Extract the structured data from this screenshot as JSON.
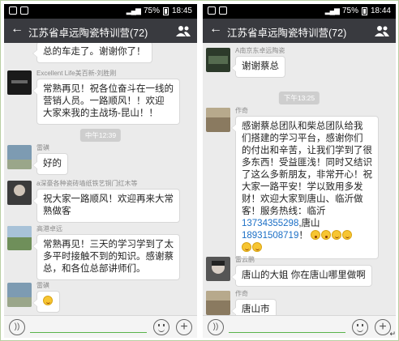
{
  "left_phone": {
    "status": {
      "battery": "75%",
      "time": "18:45"
    },
    "header": {
      "title": "江苏省卓远陶瓷特训营(72)"
    },
    "messages": [
      {
        "type": "partial",
        "text": "总的车走了。谢谢你了！"
      },
      {
        "type": "msg",
        "sender": "Excellent Life美百新-刘胜刚",
        "avatar_color": "#1a1a1a",
        "lines": [
          "常熟再见！祝各位奋斗在一线的",
          "营销人员。一路顺风！！欢迎",
          "大家来我的主战场-昆山！！"
        ]
      },
      {
        "type": "time",
        "text": "中午12:39"
      },
      {
        "type": "msg",
        "sender": "雷磺",
        "avatar_color": "#7d9bb2",
        "lines": [
          "好的"
        ]
      },
      {
        "type": "msg",
        "sender": "a深豪各种瓷砖墙纸铁艺铜门红木等",
        "avatar_color": "#3b3b3b",
        "lines": [
          "祝大家一路顺风！欢迎再来大常",
          "熟做客"
        ]
      },
      {
        "type": "msg",
        "sender": "高港卓远",
        "avatar_color": "#6f8f5a",
        "lines": [
          "常熟再见！三天的学习学到了太",
          "多平时接触不到的知识。感谢蔡",
          "总，和各位总部讲师们。"
        ]
      },
      {
        "type": "msg",
        "sender": "雷磺",
        "avatar_color": "#7d9bb2",
        "emoji": "smile"
      }
    ]
  },
  "right_phone": {
    "status": {
      "battery": "75%",
      "time": "18:44"
    },
    "header": {
      "title": "江苏省卓远陶瓷特训营(72)"
    },
    "messages": [
      {
        "type": "msg",
        "sender": "A南京东卓远陶瓷",
        "avatar_color": "#2c3a2a",
        "lines": [
          "谢谢蔡总"
        ]
      },
      {
        "type": "time",
        "text": "下午13:25"
      },
      {
        "type": "msg",
        "sender": "作奇",
        "avatar_color": "#8a7a60",
        "lines": [
          "感谢蔡总团队和柴总团队给我",
          "们搭建的学习平台，感谢你们",
          "的付出和辛苦，让我们学到了很",
          "多东西！受益匪浅！同时又结识",
          "了这么多新朋友，非常开心！祝",
          "大家一路平安！学以致用多发",
          "财！欢迎大家到唐山、临沂做",
          "客！服务热线：临沂"
        ],
        "link1": "13734355298",
        "mid": ",唐山",
        "link2": "18931508719",
        "tail": "！"
      },
      {
        "type": "msg",
        "sender": "雷云鹏",
        "avatar_color": "#555555",
        "lines": [
          "唐山的大姐  你在唐山哪里做啊"
        ]
      },
      {
        "type": "msg",
        "sender": "作奇",
        "avatar_color": "#8a7a60",
        "lines": [
          "唐山市"
        ]
      }
    ]
  },
  "icons": {
    "back": "back-arrow-icon",
    "people": "group-members-icon",
    "voice": "voice-input-icon",
    "emoji": "emoji-icon",
    "plus": "more-plus-icon"
  },
  "colors": {
    "header_bg": "#393a3f",
    "chat_bg": "#ebebeb",
    "link": "#1b6fc6",
    "input_underline": "#59b34a"
  }
}
